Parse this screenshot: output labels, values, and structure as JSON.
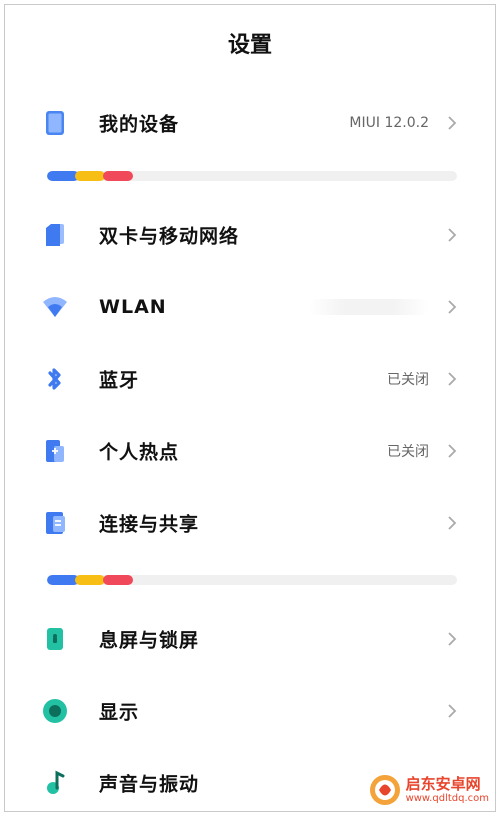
{
  "header": {
    "title": "设置"
  },
  "colors": {
    "blue": "#3f7af0",
    "yellow": "#f7be16",
    "red": "#f04a5a",
    "teal": "#22c1a4"
  },
  "rows": [
    {
      "label": "我的设备",
      "value": "MIUI 12.0.2"
    },
    {
      "label": "双卡与移动网络",
      "value": ""
    },
    {
      "label": "WLAN",
      "value": ""
    },
    {
      "label": "蓝牙",
      "value": "已关闭"
    },
    {
      "label": "个人热点",
      "value": "已关闭"
    },
    {
      "label": "连接与共享",
      "value": ""
    },
    {
      "label": "息屏与锁屏",
      "value": ""
    },
    {
      "label": "显示",
      "value": ""
    },
    {
      "label": "声音与振动",
      "value": ""
    }
  ],
  "watermark": {
    "title": "启东安卓网",
    "url": "www.qdltdq.com"
  }
}
